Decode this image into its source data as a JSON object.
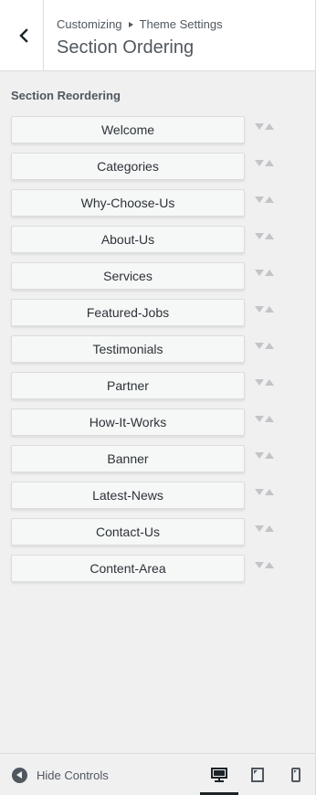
{
  "header": {
    "breadcrumb_root": "Customizing",
    "breadcrumb_current": "Theme Settings",
    "title": "Section Ordering"
  },
  "section_label": "Section Reordering",
  "sections": [
    {
      "label": "Welcome"
    },
    {
      "label": "Categories"
    },
    {
      "label": "Why-Choose-Us"
    },
    {
      "label": "About-Us"
    },
    {
      "label": "Services"
    },
    {
      "label": "Featured-Jobs"
    },
    {
      "label": "Testimonials"
    },
    {
      "label": "Partner"
    },
    {
      "label": "How-It-Works"
    },
    {
      "label": "Banner"
    },
    {
      "label": "Latest-News"
    },
    {
      "label": "Contact-Us"
    },
    {
      "label": "Content-Area"
    }
  ],
  "footer": {
    "hide_controls_label": "Hide Controls",
    "active_device": "desktop"
  },
  "icons": {
    "back": "chevron-left-icon",
    "hide": "arrow-left-circle-icon",
    "desktop": "desktop-icon",
    "tablet": "tablet-icon",
    "mobile": "mobile-icon",
    "move_down": "triangle-down-icon",
    "move_up": "triangle-up-icon"
  },
  "colors": {
    "panel_bg": "#f0f0f1",
    "header_bg": "#ffffff",
    "item_bg": "#f6f7f7",
    "arrow": "#c3c4c7",
    "text": "#50575e",
    "active_indicator": "#1d2327"
  }
}
